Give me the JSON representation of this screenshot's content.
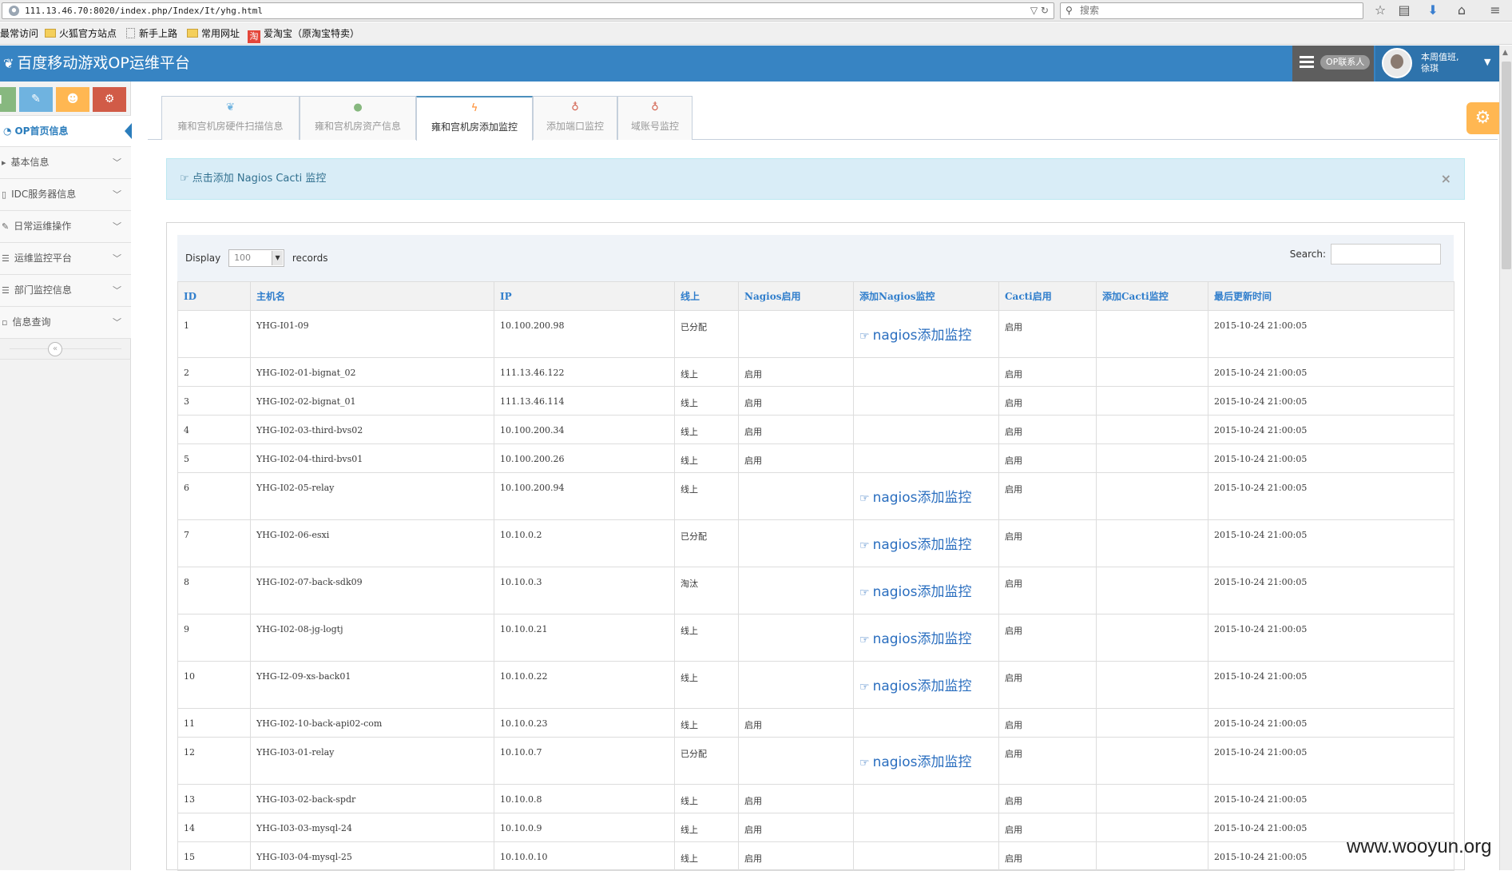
{
  "browser": {
    "url": "111.13.46.70:8020/index.php/Index/It/yhg.html",
    "search_placeholder": "搜索",
    "bookmarks": [
      "最常访问",
      "火狐官方站点",
      "新手上路",
      "常用网址",
      "爱淘宝（原淘宝特卖）"
    ]
  },
  "app": {
    "title": "百度移动游戏OP运维平台",
    "op_contact": "OP联系人",
    "user_line1": "本周值班,",
    "user_line2": "徐琪"
  },
  "sidebar": {
    "active": "OP首页信息",
    "items": [
      {
        "label": "基本信息"
      },
      {
        "label": "IDC服务器信息"
      },
      {
        "label": "日常运维操作"
      },
      {
        "label": "运维监控平台"
      },
      {
        "label": "部门监控信息"
      },
      {
        "label": "信息查询"
      }
    ],
    "shortcut_colors": [
      "#87b87f",
      "#6fb3e0",
      "#ffb752",
      "#d15b47"
    ]
  },
  "tabs": [
    {
      "label": "雍和宫机房硬件扫描信息",
      "icon": "leaf-icon",
      "color": "#6fb3e0"
    },
    {
      "label": "雍和宫机房资产信息",
      "icon": "user-icon",
      "color": "#87b87f"
    },
    {
      "label": "雍和宫机房添加监控",
      "icon": "bolt-icon",
      "color": "#ff892a"
    },
    {
      "label": "添加端口监控",
      "icon": "bulb-icon",
      "color": "#d15b47"
    },
    {
      "label": "域账号监控",
      "icon": "bulb-icon",
      "color": "#d15b47"
    }
  ],
  "alert": {
    "text": "点击添加 Nagios Cacti 监控",
    "close": "×"
  },
  "table_controls": {
    "display_label": "Display",
    "display_value": "100",
    "records_label": "records",
    "search_label": "Search:"
  },
  "table": {
    "headers": [
      "ID",
      "主机名",
      "IP",
      "线上",
      "Nagios启用",
      "添加Nagios监控",
      "Cacti启用",
      "添加Cacti监控",
      "最后更新时间"
    ],
    "action_label": "nagios添加监控",
    "rows": [
      {
        "id": "1",
        "host": "YHG-I01-09",
        "ip": "10.100.200.98",
        "status": "已分配",
        "nagios": "",
        "action": true,
        "cacti": "启用",
        "cacti_add": "",
        "updated": "2015-10-24 21:00:05"
      },
      {
        "id": "2",
        "host": "YHG-I02-01-bignat_02",
        "ip": "111.13.46.122",
        "status": "线上",
        "nagios": "启用",
        "action": false,
        "cacti": "启用",
        "cacti_add": "",
        "updated": "2015-10-24 21:00:05"
      },
      {
        "id": "3",
        "host": "YHG-I02-02-bignat_01",
        "ip": "111.13.46.114",
        "status": "线上",
        "nagios": "启用",
        "action": false,
        "cacti": "启用",
        "cacti_add": "",
        "updated": "2015-10-24 21:00:05"
      },
      {
        "id": "4",
        "host": "YHG-I02-03-third-bvs02",
        "ip": "10.100.200.34",
        "status": "线上",
        "nagios": "启用",
        "action": false,
        "cacti": "启用",
        "cacti_add": "",
        "updated": "2015-10-24 21:00:05"
      },
      {
        "id": "5",
        "host": "YHG-I02-04-third-bvs01",
        "ip": "10.100.200.26",
        "status": "线上",
        "nagios": "启用",
        "action": false,
        "cacti": "启用",
        "cacti_add": "",
        "updated": "2015-10-24 21:00:05"
      },
      {
        "id": "6",
        "host": "YHG-I02-05-relay",
        "ip": "10.100.200.94",
        "status": "线上",
        "nagios": "",
        "action": true,
        "cacti": "启用",
        "cacti_add": "",
        "updated": "2015-10-24 21:00:05"
      },
      {
        "id": "7",
        "host": "YHG-I02-06-esxi",
        "ip": "10.10.0.2",
        "status": "已分配",
        "nagios": "",
        "action": true,
        "cacti": "启用",
        "cacti_add": "",
        "updated": "2015-10-24 21:00:05"
      },
      {
        "id": "8",
        "host": "YHG-I02-07-back-sdk09",
        "ip": "10.10.0.3",
        "status": "淘汰",
        "nagios": "",
        "action": true,
        "cacti": "启用",
        "cacti_add": "",
        "updated": "2015-10-24 21:00:05"
      },
      {
        "id": "9",
        "host": "YHG-I02-08-jg-logtj",
        "ip": "10.10.0.21",
        "status": "线上",
        "nagios": "",
        "action": true,
        "cacti": "启用",
        "cacti_add": "",
        "updated": "2015-10-24 21:00:05"
      },
      {
        "id": "10",
        "host": "YHG-I2-09-xs-back01",
        "ip": "10.10.0.22",
        "status": "线上",
        "nagios": "",
        "action": true,
        "cacti": "启用",
        "cacti_add": "",
        "updated": "2015-10-24 21:00:05"
      },
      {
        "id": "11",
        "host": "YHG-I02-10-back-api02-com",
        "ip": "10.10.0.23",
        "status": "线上",
        "nagios": "启用",
        "action": false,
        "cacti": "启用",
        "cacti_add": "",
        "updated": "2015-10-24 21:00:05"
      },
      {
        "id": "12",
        "host": "YHG-I03-01-relay",
        "ip": "10.10.0.7",
        "status": "已分配",
        "nagios": "",
        "action": true,
        "cacti": "启用",
        "cacti_add": "",
        "updated": "2015-10-24 21:00:05"
      },
      {
        "id": "13",
        "host": "YHG-I03-02-back-spdr",
        "ip": "10.10.0.8",
        "status": "线上",
        "nagios": "启用",
        "action": false,
        "cacti": "启用",
        "cacti_add": "",
        "updated": "2015-10-24 21:00:05"
      },
      {
        "id": "14",
        "host": "YHG-I03-03-mysql-24",
        "ip": "10.10.0.9",
        "status": "线上",
        "nagios": "启用",
        "action": false,
        "cacti": "启用",
        "cacti_add": "",
        "updated": "2015-10-24 21:00:05"
      },
      {
        "id": "15",
        "host": "YHG-I03-04-mysql-25",
        "ip": "10.10.0.10",
        "status": "线上",
        "nagios": "启用",
        "action": false,
        "cacti": "启用",
        "cacti_add": "",
        "updated": "2015-10-24 21:00:05"
      }
    ]
  },
  "watermark": "www.wooyun.org",
  "colors": {
    "header": "#3784c3",
    "accent": "#307ecc",
    "alert_bg": "#d9edf7"
  }
}
